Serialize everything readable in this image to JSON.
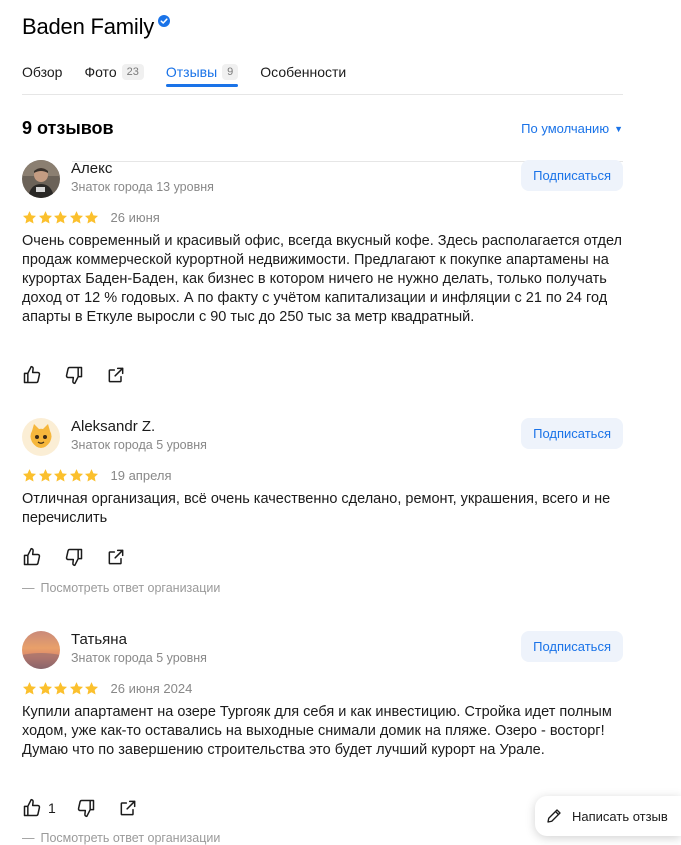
{
  "org": {
    "name": "Baden Family",
    "verified": true
  },
  "tabs": [
    {
      "label": "Обзор",
      "count": ""
    },
    {
      "label": "Фото",
      "count": "23"
    },
    {
      "label": "Отзывы",
      "count": "9",
      "active": true
    },
    {
      "label": "Особенности",
      "count": ""
    }
  ],
  "reviews_header": {
    "title": "9 отзывов",
    "sort_label": "По умолчанию"
  },
  "reviews": [
    {
      "author": "Алекс",
      "level": "Знаток города 13 уровня",
      "subscribe": "Подписаться",
      "rating": 5,
      "date": "26 июня",
      "text": "Очень современный и красивый офис, всегда вкусный кофе. Здесь располагается отдел продаж коммерческой курортной недвижимости. Предлагают к покупке апартамены на курортах Баден-Баден, как бизнес в котором ничего не нужно делать, только получать доход от 12 % годовых. А по факту с учётом капитализации и инфляции с 21 по 24 год апарты в Еткуле выросли с 90 тыс до 250 тыс за метр квадратный.",
      "likes": "",
      "org_reply": ""
    },
    {
      "author": "Aleksandr Z.",
      "level": "Знаток города 5 уровня",
      "subscribe": "Подписаться",
      "rating": 5,
      "date": "19 апреля",
      "text": "Отличная организация, всё очень качественно сделано, ремонт, украшения, всего и не перечислить",
      "likes": "",
      "org_reply": "Посмотреть ответ организации"
    },
    {
      "author": "Татьяна",
      "level": "Знаток города 5 уровня",
      "subscribe": "Подписаться",
      "rating": 5,
      "date": "26 июня 2024",
      "text": "Купили апартамент на озере Тургояк для себя и как инвестицию. Стройка идет полным ходом, уже как-то оставались на выходные снимали домик на пляже. Озеро - восторг! Думаю что по завершению строительства это будет лучший курорт на Урале.",
      "likes": "1",
      "org_reply": "Посмотреть ответ организации"
    }
  ],
  "write_review": {
    "label": "Написать отзыв"
  },
  "colors": {
    "accent": "#1a73e8",
    "star": "#fbc02d",
    "muted": "#888888"
  }
}
